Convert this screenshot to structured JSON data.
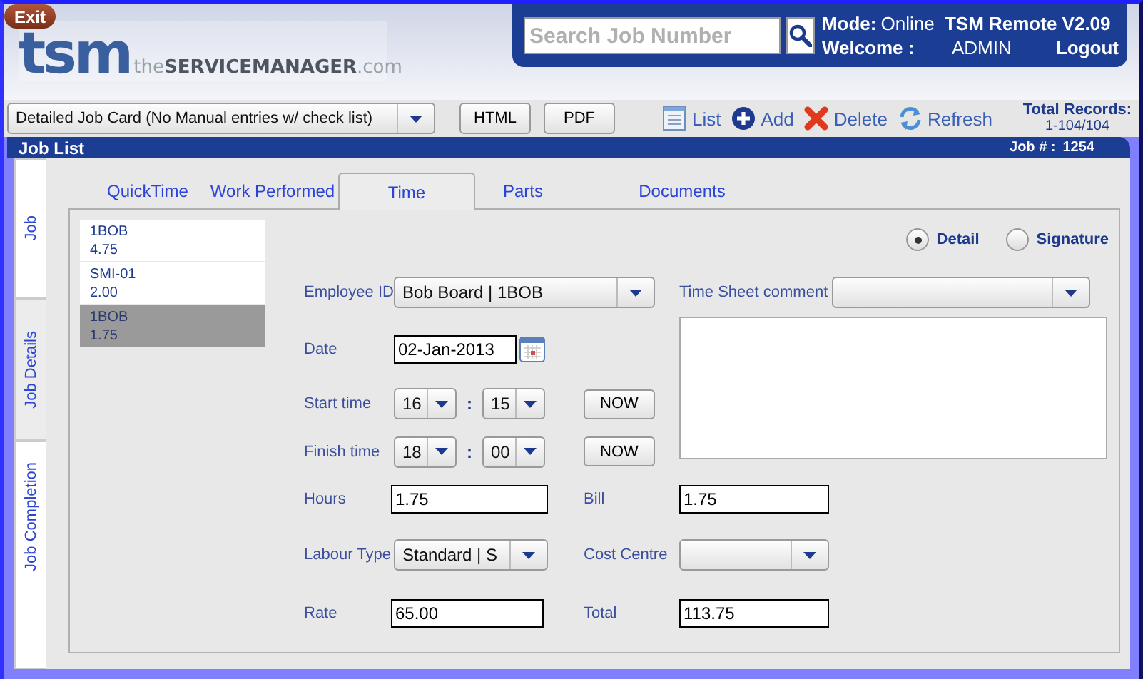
{
  "header": {
    "exit": "Exit",
    "logo_mark": "tsm",
    "logo_tagline": "the**SERVICEMANAGER**.com",
    "search": {
      "placeholder": "Search Job Number"
    },
    "mode_label": "Mode:",
    "mode": "Online",
    "app_title": "TSM Remote V2.09",
    "welcome_label": "Welcome :",
    "user": "ADMIN",
    "logout": "Logout"
  },
  "toolbar": {
    "report": "Detailed Job Card (No Manual entries w/ check list)",
    "buttons": [
      "HTML",
      "PDF"
    ],
    "actions": [
      {
        "label": "List",
        "kind": "list"
      },
      {
        "label": "Add",
        "kind": "add"
      },
      {
        "label": "Delete",
        "kind": "delete"
      },
      {
        "label": "Refresh",
        "kind": "refresh"
      }
    ],
    "total_records_label": "Total Records:",
    "total_records": "1-104/104"
  },
  "job_list": {
    "title": "Job List",
    "job_number_label": "Job # :",
    "job_number": "1254"
  },
  "side_tabs": [
    {
      "label": "Job",
      "selected": false
    },
    {
      "label": "Job Details",
      "selected": true
    },
    {
      "label": "Job Completion",
      "selected": false
    }
  ],
  "tabs": [
    {
      "label": "QuickTime",
      "selected": false
    },
    {
      "label": "Work Performed",
      "selected": false
    },
    {
      "label": "Time",
      "selected": true
    },
    {
      "label": "Parts",
      "selected": false
    },
    {
      "label": "Documents",
      "selected": false
    }
  ],
  "entries": [
    {
      "code": "1BOB",
      "hours": "4.75",
      "selected": false
    },
    {
      "code": "SMI-01",
      "hours": "2.00",
      "selected": false
    },
    {
      "code": "1BOB",
      "hours": "1.75",
      "selected": true
    }
  ],
  "view_options": [
    {
      "label": "Detail",
      "selected": true
    },
    {
      "label": "Signature",
      "selected": false
    }
  ],
  "form": {
    "employee_id": {
      "label": "Employee ID",
      "value": "Bob Board | 1BOB"
    },
    "date": {
      "label": "Date",
      "value": "02-Jan-2013"
    },
    "start_time": {
      "label": "Start time",
      "hour": "16",
      "separator": ":",
      "minute": "15",
      "now_button": "NOW"
    },
    "finish_time": {
      "label": "Finish time",
      "hour": "18",
      "separator": ":",
      "minute": "00",
      "now_button": "NOW"
    },
    "hours": {
      "label": "Hours",
      "value": "1.75"
    },
    "labour_type": {
      "label": "Labour Type",
      "value": "Standard | S"
    },
    "rate": {
      "label": "Rate",
      "value": "65.00"
    },
    "time_sheet_comment": {
      "label": "Time Sheet comment"
    },
    "bill": {
      "label": "Bill",
      "value": "1.75"
    },
    "cost_centre": {
      "label": "Cost Centre"
    },
    "total": {
      "label": "Total",
      "value": "113.75"
    }
  }
}
